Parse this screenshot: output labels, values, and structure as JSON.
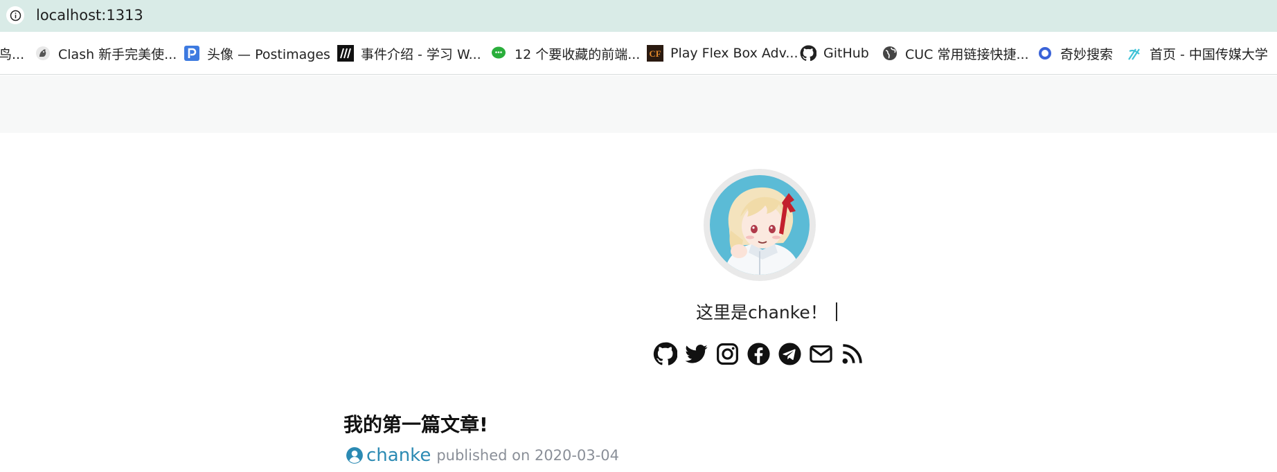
{
  "browser": {
    "url": "localhost:1313"
  },
  "bookmarks": [
    {
      "label": "鸟...",
      "icon": "none"
    },
    {
      "label": "Clash 新手完美使...",
      "icon": "clash-cat-icon"
    },
    {
      "label": "头像 — Postimages",
      "icon": "postimages-icon"
    },
    {
      "label": "事件介绍 - 学习 W...",
      "icon": "mdn-icon"
    },
    {
      "label": "12 个要收藏的前端...",
      "icon": "wechat-icon"
    },
    {
      "label": "Play Flex Box Adv...",
      "icon": "flexbox-game-icon"
    },
    {
      "label": "GitHub",
      "icon": "github-icon"
    },
    {
      "label": "CUC 常用链接快捷...",
      "icon": "globe-icon"
    },
    {
      "label": "奇妙搜索",
      "icon": "search-ring-icon"
    },
    {
      "label": "首页 - 中国传媒大学",
      "icon": "cuc-logo-icon"
    }
  ],
  "profile": {
    "avatar_icon": "anime-avatar",
    "tagline": "这里是chanke！",
    "social_icons": [
      "github-icon",
      "twitter-icon",
      "instagram-icon",
      "facebook-icon",
      "telegram-icon",
      "email-icon",
      "rss-icon"
    ]
  },
  "post": {
    "title": "我的第一篇文章!",
    "author": "chanke",
    "published_prefix": "published on",
    "date": "2020-03-04",
    "published_text": "published on 2020-03-04"
  },
  "colors": {
    "address_bar": "#d9ebe7",
    "header_band": "#f7f8f8",
    "author_link": "#2b8ab3",
    "meta_text": "#8a8f98"
  }
}
